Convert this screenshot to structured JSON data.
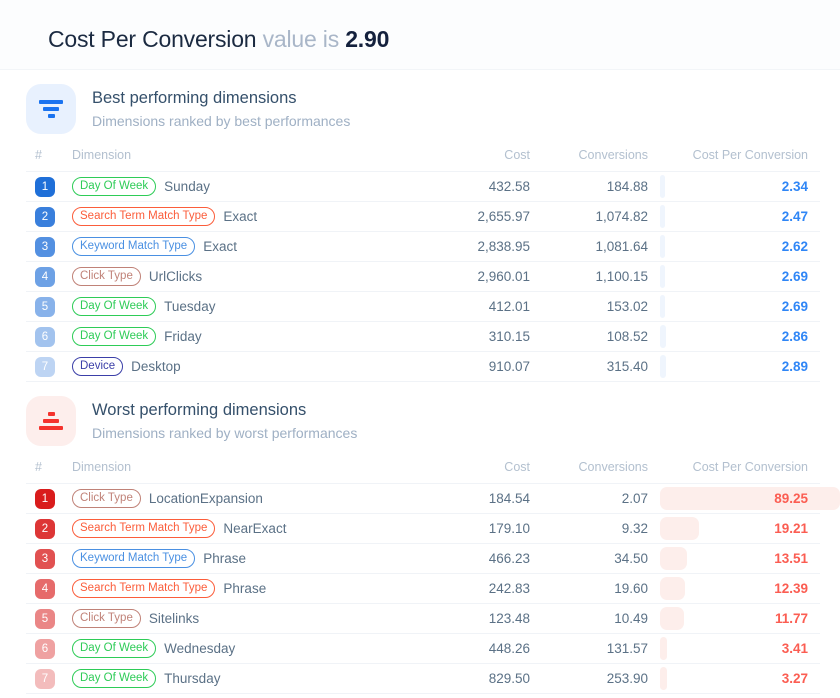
{
  "header": {
    "metric": "Cost Per Conversion",
    "mid": "value is",
    "value": "2.90"
  },
  "columns": {
    "rank": "#",
    "dimension": "Dimension",
    "cost": "Cost",
    "conversions": "Conversions",
    "cost_per_conversion": "Cost Per Conversion"
  },
  "colors": {
    "best_accent": "#2f86f6",
    "worst_accent": "#fb5d52",
    "best_icon_bg": "#e8f1fe",
    "worst_icon_bg": "#fdeeec",
    "chip_day_of_week": "#2ecc57",
    "chip_search_term_match_type": "#fb5d3b",
    "chip_keyword_match_type": "#4a90e2",
    "chip_click_type": "#c08278",
    "chip_device": "#3b3fa8"
  },
  "bar_scale_max": 89.25,
  "sections": [
    {
      "id": "best",
      "icon": "filter-descending-icon",
      "title": "Best performing dimensions",
      "subtitle": "Dimensions ranked by best performances",
      "rank_color": "#1f6fd8",
      "rows": [
        {
          "rank": "1",
          "chip": "Day Of Week",
          "chip_key": "chip_day_of_week",
          "value": "Sunday",
          "cost": "432.58",
          "conversions": "184.88",
          "cpc": "2.34",
          "cpc_num": 2.34
        },
        {
          "rank": "2",
          "chip": "Search Term Match Type",
          "chip_key": "chip_search_term_match_type",
          "value": "Exact",
          "cost": "2,655.97",
          "conversions": "1,074.82",
          "cpc": "2.47",
          "cpc_num": 2.47
        },
        {
          "rank": "3",
          "chip": "Keyword Match Type",
          "chip_key": "chip_keyword_match_type",
          "value": "Exact",
          "cost": "2,838.95",
          "conversions": "1,081.64",
          "cpc": "2.62",
          "cpc_num": 2.62
        },
        {
          "rank": "4",
          "chip": "Click Type",
          "chip_key": "chip_click_type",
          "value": "UrlClicks",
          "cost": "2,960.01",
          "conversions": "1,100.15",
          "cpc": "2.69",
          "cpc_num": 2.69
        },
        {
          "rank": "5",
          "chip": "Day Of Week",
          "chip_key": "chip_day_of_week",
          "value": "Tuesday",
          "cost": "412.01",
          "conversions": "153.02",
          "cpc": "2.69",
          "cpc_num": 2.69
        },
        {
          "rank": "6",
          "chip": "Day Of Week",
          "chip_key": "chip_day_of_week",
          "value": "Friday",
          "cost": "310.15",
          "conversions": "108.52",
          "cpc": "2.86",
          "cpc_num": 2.86
        },
        {
          "rank": "7",
          "chip": "Device",
          "chip_key": "chip_device",
          "value": "Desktop",
          "cost": "910.07",
          "conversions": "315.40",
          "cpc": "2.89",
          "cpc_num": 2.89
        }
      ]
    },
    {
      "id": "worst",
      "icon": "filter-ascending-icon",
      "title": "Worst performing dimensions",
      "subtitle": "Dimensions ranked by worst performances",
      "rank_color": "#d91c1c",
      "rows": [
        {
          "rank": "1",
          "chip": "Click Type",
          "chip_key": "chip_click_type",
          "value": "LocationExpansion",
          "cost": "184.54",
          "conversions": "2.07",
          "cpc": "89.25",
          "cpc_num": 89.25
        },
        {
          "rank": "2",
          "chip": "Search Term Match Type",
          "chip_key": "chip_search_term_match_type",
          "value": "NearExact",
          "cost": "179.10",
          "conversions": "9.32",
          "cpc": "19.21",
          "cpc_num": 19.21
        },
        {
          "rank": "3",
          "chip": "Keyword Match Type",
          "chip_key": "chip_keyword_match_type",
          "value": "Phrase",
          "cost": "466.23",
          "conversions": "34.50",
          "cpc": "13.51",
          "cpc_num": 13.51
        },
        {
          "rank": "4",
          "chip": "Search Term Match Type",
          "chip_key": "chip_search_term_match_type",
          "value": "Phrase",
          "cost": "242.83",
          "conversions": "19.60",
          "cpc": "12.39",
          "cpc_num": 12.39
        },
        {
          "rank": "5",
          "chip": "Click Type",
          "chip_key": "chip_click_type",
          "value": "Sitelinks",
          "cost": "123.48",
          "conversions": "10.49",
          "cpc": "11.77",
          "cpc_num": 11.77
        },
        {
          "rank": "6",
          "chip": "Day Of Week",
          "chip_key": "chip_day_of_week",
          "value": "Wednesday",
          "cost": "448.26",
          "conversions": "131.57",
          "cpc": "3.41",
          "cpc_num": 3.41
        },
        {
          "rank": "7",
          "chip": "Day Of Week",
          "chip_key": "chip_day_of_week",
          "value": "Thursday",
          "cost": "829.50",
          "conversions": "253.90",
          "cpc": "3.27",
          "cpc_num": 3.27
        }
      ]
    }
  ]
}
